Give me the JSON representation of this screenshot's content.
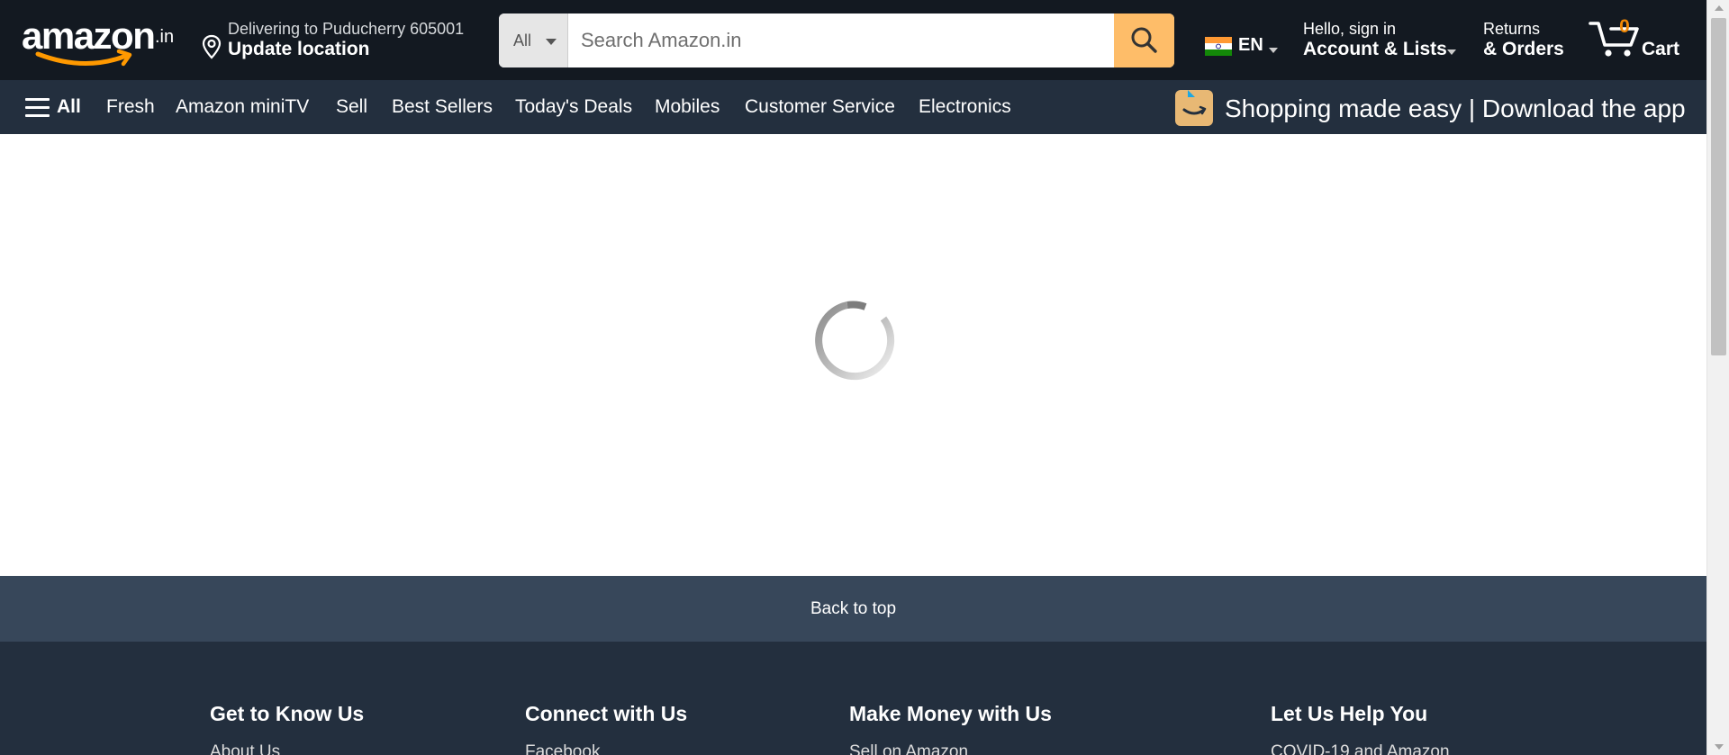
{
  "header": {
    "logo": {
      "text": "amazon",
      "suffix": ".in"
    },
    "deliver": {
      "line1": "Delivering to Puducherry 605001",
      "line2": "Update location",
      "icon": "location-pin-icon"
    },
    "search": {
      "category": "All",
      "placeholder": "Search Amazon.in",
      "value": "",
      "icon": "search-icon"
    },
    "language": {
      "code": "EN",
      "flag": "india-flag-icon"
    },
    "account": {
      "line1": "Hello, sign in",
      "line2": "Account & Lists"
    },
    "returns": {
      "line1": "Returns",
      "line2": "& Orders"
    },
    "cart": {
      "count": "0",
      "label": "Cart",
      "icon": "cart-icon"
    }
  },
  "subnav": {
    "all_label": "All",
    "links": [
      "Fresh",
      "Amazon miniTV",
      "Sell",
      "Best Sellers",
      "Today's Deals",
      "Mobiles",
      "Customer Service",
      "Electronics"
    ],
    "promo": "Shopping made easy | Download the app"
  },
  "main": {
    "state": "loading",
    "icon": "loading-spinner-icon"
  },
  "back_to_top": "Back to top",
  "footer": {
    "columns": [
      {
        "heading": "Get to Know Us",
        "first_link": "About Us"
      },
      {
        "heading": "Connect with Us",
        "first_link": "Facebook"
      },
      {
        "heading": "Make Money with Us",
        "first_link": "Sell on Amazon"
      },
      {
        "heading": "Let Us Help You",
        "first_link": "COVID-19 and Amazon"
      }
    ]
  },
  "colors": {
    "nav_bg": "#131921",
    "subnav_bg": "#232f3e",
    "search_button": "#febd69",
    "cart_count": "#f08804",
    "back_to_top_bg": "#37475a",
    "logo_smile": "#ff9900"
  }
}
